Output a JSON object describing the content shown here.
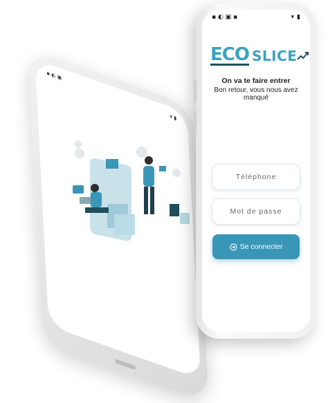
{
  "front_phone": {
    "status_time": "",
    "logo": {
      "part1": "ECO",
      "part2": "SLICE"
    },
    "title": "On va te faire entrer",
    "subtitle": "Bon retour, vous nous avez manqué",
    "phone_placeholder": "Téléphone",
    "password_placeholder": "Mot de passe",
    "login_label": "Se connecter"
  },
  "colors": {
    "accent": "#3a96b6",
    "logo": "#3aa3bf",
    "logo_dark": "#1f4f5c"
  },
  "icons": [
    "login-icon",
    "shopping-cart-icon",
    "wifi-icon",
    "battery-icon"
  ]
}
